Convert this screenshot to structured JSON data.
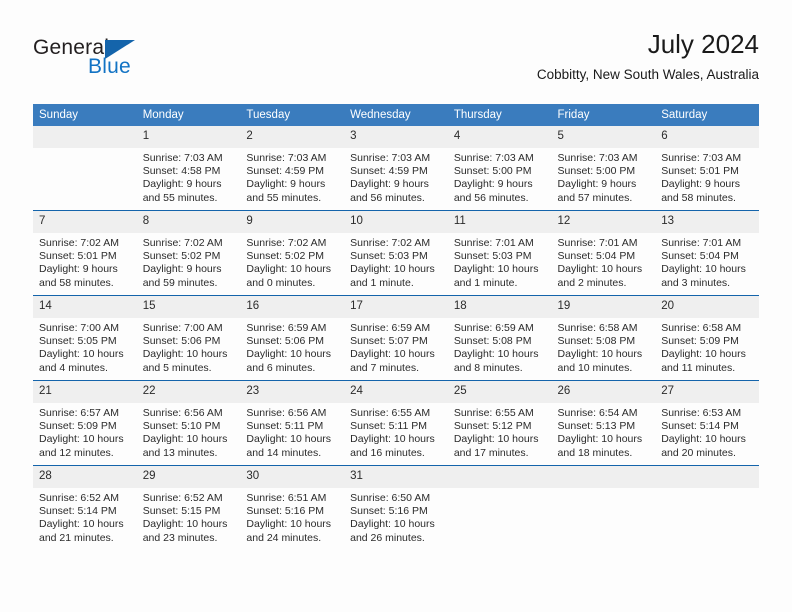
{
  "brand": {
    "name_part1": "General",
    "name_part2": "Blue",
    "triangle_icon": "triangle-icon",
    "accent_color": "#1464ab"
  },
  "header": {
    "month_title": "July 2024",
    "location": "Cobbitty, New South Wales, Australia"
  },
  "calendar": {
    "header_background": "#3a7cbe",
    "daynum_background": "#efefef",
    "weekday_headers": [
      "Sunday",
      "Monday",
      "Tuesday",
      "Wednesday",
      "Thursday",
      "Friday",
      "Saturday"
    ],
    "weeks": [
      [
        {
          "day": "",
          "empty": true,
          "sunrise": "",
          "sunset": "",
          "daylight": ""
        },
        {
          "day": "1",
          "sunrise": "Sunrise: 7:03 AM",
          "sunset": "Sunset: 4:58 PM",
          "daylight": "Daylight: 9 hours and 55 minutes."
        },
        {
          "day": "2",
          "sunrise": "Sunrise: 7:03 AM",
          "sunset": "Sunset: 4:59 PM",
          "daylight": "Daylight: 9 hours and 55 minutes."
        },
        {
          "day": "3",
          "sunrise": "Sunrise: 7:03 AM",
          "sunset": "Sunset: 4:59 PM",
          "daylight": "Daylight: 9 hours and 56 minutes."
        },
        {
          "day": "4",
          "sunrise": "Sunrise: 7:03 AM",
          "sunset": "Sunset: 5:00 PM",
          "daylight": "Daylight: 9 hours and 56 minutes."
        },
        {
          "day": "5",
          "sunrise": "Sunrise: 7:03 AM",
          "sunset": "Sunset: 5:00 PM",
          "daylight": "Daylight: 9 hours and 57 minutes."
        },
        {
          "day": "6",
          "sunrise": "Sunrise: 7:03 AM",
          "sunset": "Sunset: 5:01 PM",
          "daylight": "Daylight: 9 hours and 58 minutes."
        }
      ],
      [
        {
          "day": "7",
          "sunrise": "Sunrise: 7:02 AM",
          "sunset": "Sunset: 5:01 PM",
          "daylight": "Daylight: 9 hours and 58 minutes."
        },
        {
          "day": "8",
          "sunrise": "Sunrise: 7:02 AM",
          "sunset": "Sunset: 5:02 PM",
          "daylight": "Daylight: 9 hours and 59 minutes."
        },
        {
          "day": "9",
          "sunrise": "Sunrise: 7:02 AM",
          "sunset": "Sunset: 5:02 PM",
          "daylight": "Daylight: 10 hours and 0 minutes."
        },
        {
          "day": "10",
          "sunrise": "Sunrise: 7:02 AM",
          "sunset": "Sunset: 5:03 PM",
          "daylight": "Daylight: 10 hours and 1 minute."
        },
        {
          "day": "11",
          "sunrise": "Sunrise: 7:01 AM",
          "sunset": "Sunset: 5:03 PM",
          "daylight": "Daylight: 10 hours and 1 minute."
        },
        {
          "day": "12",
          "sunrise": "Sunrise: 7:01 AM",
          "sunset": "Sunset: 5:04 PM",
          "daylight": "Daylight: 10 hours and 2 minutes."
        },
        {
          "day": "13",
          "sunrise": "Sunrise: 7:01 AM",
          "sunset": "Sunset: 5:04 PM",
          "daylight": "Daylight: 10 hours and 3 minutes."
        }
      ],
      [
        {
          "day": "14",
          "sunrise": "Sunrise: 7:00 AM",
          "sunset": "Sunset: 5:05 PM",
          "daylight": "Daylight: 10 hours and 4 minutes."
        },
        {
          "day": "15",
          "sunrise": "Sunrise: 7:00 AM",
          "sunset": "Sunset: 5:06 PM",
          "daylight": "Daylight: 10 hours and 5 minutes."
        },
        {
          "day": "16",
          "sunrise": "Sunrise: 6:59 AM",
          "sunset": "Sunset: 5:06 PM",
          "daylight": "Daylight: 10 hours and 6 minutes."
        },
        {
          "day": "17",
          "sunrise": "Sunrise: 6:59 AM",
          "sunset": "Sunset: 5:07 PM",
          "daylight": "Daylight: 10 hours and 7 minutes."
        },
        {
          "day": "18",
          "sunrise": "Sunrise: 6:59 AM",
          "sunset": "Sunset: 5:08 PM",
          "daylight": "Daylight: 10 hours and 8 minutes."
        },
        {
          "day": "19",
          "sunrise": "Sunrise: 6:58 AM",
          "sunset": "Sunset: 5:08 PM",
          "daylight": "Daylight: 10 hours and 10 minutes."
        },
        {
          "day": "20",
          "sunrise": "Sunrise: 6:58 AM",
          "sunset": "Sunset: 5:09 PM",
          "daylight": "Daylight: 10 hours and 11 minutes."
        }
      ],
      [
        {
          "day": "21",
          "sunrise": "Sunrise: 6:57 AM",
          "sunset": "Sunset: 5:09 PM",
          "daylight": "Daylight: 10 hours and 12 minutes."
        },
        {
          "day": "22",
          "sunrise": "Sunrise: 6:56 AM",
          "sunset": "Sunset: 5:10 PM",
          "daylight": "Daylight: 10 hours and 13 minutes."
        },
        {
          "day": "23",
          "sunrise": "Sunrise: 6:56 AM",
          "sunset": "Sunset: 5:11 PM",
          "daylight": "Daylight: 10 hours and 14 minutes."
        },
        {
          "day": "24",
          "sunrise": "Sunrise: 6:55 AM",
          "sunset": "Sunset: 5:11 PM",
          "daylight": "Daylight: 10 hours and 16 minutes."
        },
        {
          "day": "25",
          "sunrise": "Sunrise: 6:55 AM",
          "sunset": "Sunset: 5:12 PM",
          "daylight": "Daylight: 10 hours and 17 minutes."
        },
        {
          "day": "26",
          "sunrise": "Sunrise: 6:54 AM",
          "sunset": "Sunset: 5:13 PM",
          "daylight": "Daylight: 10 hours and 18 minutes."
        },
        {
          "day": "27",
          "sunrise": "Sunrise: 6:53 AM",
          "sunset": "Sunset: 5:14 PM",
          "daylight": "Daylight: 10 hours and 20 minutes."
        }
      ],
      [
        {
          "day": "28",
          "sunrise": "Sunrise: 6:52 AM",
          "sunset": "Sunset: 5:14 PM",
          "daylight": "Daylight: 10 hours and 21 minutes."
        },
        {
          "day": "29",
          "sunrise": "Sunrise: 6:52 AM",
          "sunset": "Sunset: 5:15 PM",
          "daylight": "Daylight: 10 hours and 23 minutes."
        },
        {
          "day": "30",
          "sunrise": "Sunrise: 6:51 AM",
          "sunset": "Sunset: 5:16 PM",
          "daylight": "Daylight: 10 hours and 24 minutes."
        },
        {
          "day": "31",
          "sunrise": "Sunrise: 6:50 AM",
          "sunset": "Sunset: 5:16 PM",
          "daylight": "Daylight: 10 hours and 26 minutes."
        },
        {
          "day": "",
          "empty": true,
          "sunrise": "",
          "sunset": "",
          "daylight": ""
        },
        {
          "day": "",
          "empty": true,
          "sunrise": "",
          "sunset": "",
          "daylight": ""
        },
        {
          "day": "",
          "empty": true,
          "sunrise": "",
          "sunset": "",
          "daylight": ""
        }
      ]
    ]
  }
}
